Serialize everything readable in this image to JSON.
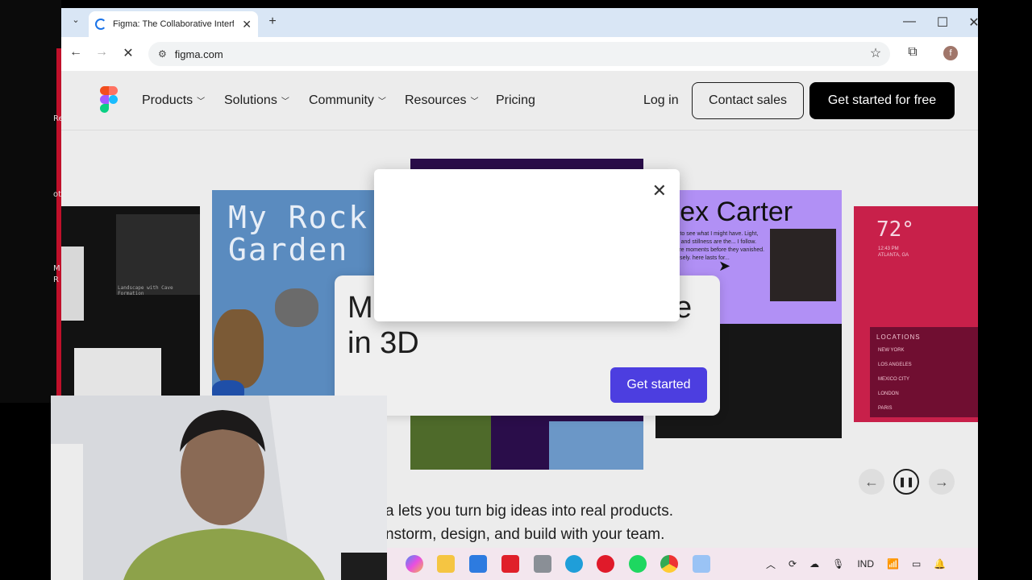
{
  "browser": {
    "tab_title": "Figma: The Collaborative Interf",
    "url": "figma.com",
    "new_tab": "+",
    "window_controls": [
      "—",
      "☐",
      "✕"
    ],
    "profile_initial": "f"
  },
  "nav": {
    "items": [
      {
        "label": "Products",
        "dropdown": true
      },
      {
        "label": "Solutions",
        "dropdown": true
      },
      {
        "label": "Community",
        "dropdown": true
      },
      {
        "label": "Resources",
        "dropdown": true
      },
      {
        "label": "Pricing",
        "dropdown": false
      }
    ],
    "login": "Log in",
    "contact": "Contact sales",
    "cta": "Get started for free"
  },
  "gallery": {
    "rock_title": "My Rock Garden",
    "rock_caption": "Landscape with Cave Formation",
    "alex_title": "Alex Carter",
    "alex_body": "pictures to see what I might have. Light, shadow, and stillness are the... I follow. These are moments before they vanished. Look closely. here lasts for...",
    "weather": {
      "temp": "72°",
      "time": "12:43 PM",
      "city": "ATLANTA, GA",
      "locations_label": "LOCATIONS",
      "locations": [
        "NEW YORK",
        "LOS ANGELES",
        "MEXICO CITY",
        "LONDON",
        "PARIS"
      ]
    }
  },
  "promo": {
    "heading_line1": "M",
    "heading_tail": "e",
    "heading_line2": "in 3D",
    "button": "Get started"
  },
  "tagline": {
    "line1": "a lets you turn big ideas into real products.",
    "line2": "nstorm, design, and build with your team."
  },
  "carousel": {
    "prev": "←",
    "pause": "❚❚",
    "next": "→"
  },
  "taskbar": {
    "language": "IND",
    "icons": [
      "copilot-icon",
      "file-explorer-icon",
      "store-icon",
      "l-app-icon",
      "camera-icon",
      "edge-icon",
      "opera-icon",
      "spotify-icon",
      "chrome-icon",
      "snipping-tool-icon"
    ]
  },
  "desktop_labels": [
    "Re",
    "ot",
    "M",
    "R"
  ]
}
